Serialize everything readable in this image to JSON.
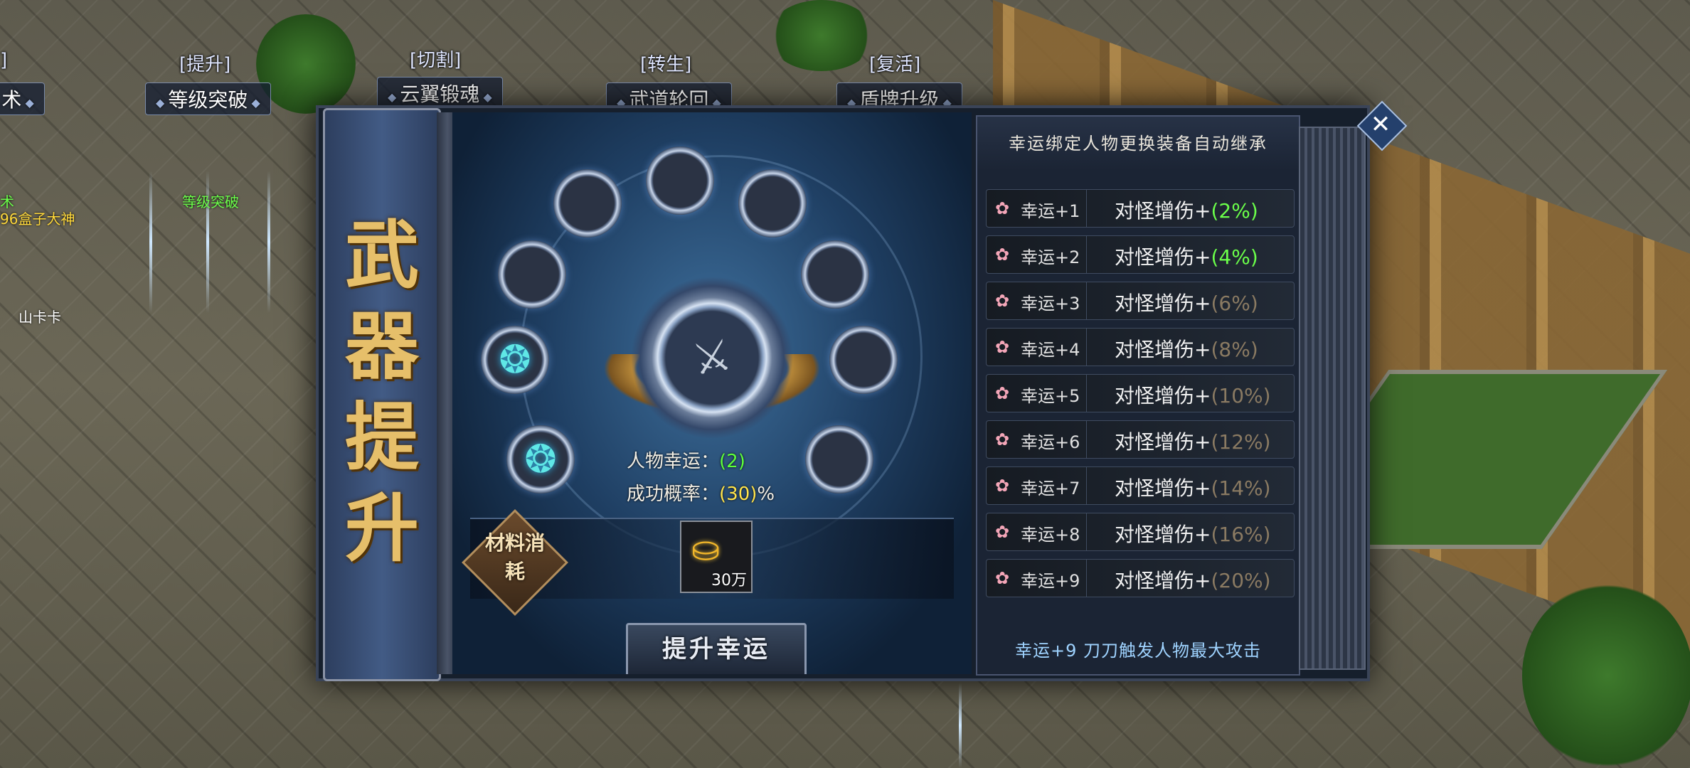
{
  "scene": {
    "npcs": [
      {
        "tag": "[提升]",
        "title": "等级突破"
      },
      {
        "tag": "[切割]",
        "title": "云翼锻魂"
      },
      {
        "tag": "[转生]",
        "title": "武道轮回"
      },
      {
        "tag": "[复活]",
        "title": "盾牌升级"
      }
    ],
    "left_partial_tag": "]",
    "left_partial_title": "术",
    "npc_name_green": "等级突破",
    "player_left_green": "术",
    "player_name_yellow": "96盒子大神",
    "player_name_white": "山卡卡"
  },
  "dialog": {
    "banner_title": "武器提升",
    "core_icon": "sword-icon",
    "stats": {
      "luck_label": "人物幸运：",
      "luck_value": "(2)",
      "rate_label": "成功概率：",
      "rate_value": "(30)",
      "rate_suffix": "%"
    },
    "materials": {
      "badge": "材料消耗",
      "item_icon": "gold-ingot-icon",
      "item_count": "30万"
    },
    "upgrade_button": "提升幸运",
    "panel": {
      "header": "幸运绑定人物更换装备自动继承",
      "effect_prefix": "对怪增伤+",
      "rows": [
        {
          "level": "幸运+1",
          "pct": "(2%)",
          "active": true
        },
        {
          "level": "幸运+2",
          "pct": "(4%)",
          "active": true
        },
        {
          "level": "幸运+3",
          "pct": "(6%)",
          "active": false
        },
        {
          "level": "幸运+4",
          "pct": "(8%)",
          "active": false
        },
        {
          "level": "幸运+5",
          "pct": "(10%)",
          "active": false
        },
        {
          "level": "幸运+6",
          "pct": "(12%)",
          "active": false
        },
        {
          "level": "幸运+7",
          "pct": "(14%)",
          "active": false
        },
        {
          "level": "幸运+8",
          "pct": "(16%)",
          "active": false
        },
        {
          "level": "幸运+9",
          "pct": "(20%)",
          "active": false
        }
      ],
      "footer": "幸运+9 刀刀触发人物最大攻击"
    },
    "close_label": "✕"
  },
  "colors": {
    "active_green": "#6bff4a",
    "inactive_brown": "#8a7a62",
    "banner_gold": "#e6bf6a",
    "footer_blue": "#9fd3ff"
  }
}
